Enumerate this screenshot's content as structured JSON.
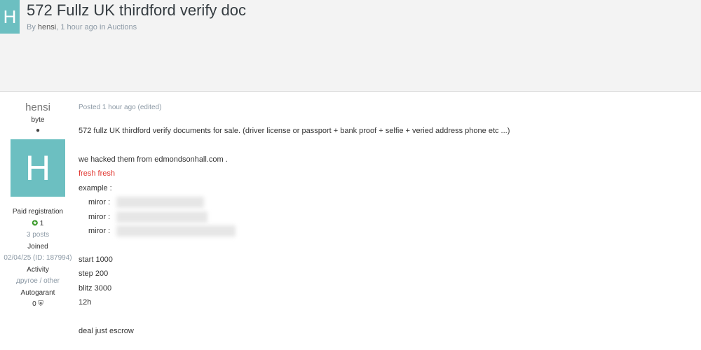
{
  "header": {
    "avatar_letter": "H",
    "title": "572 Fullz UK thirdford verify doc",
    "by_prefix": "By",
    "author": "hensi",
    "meta_suffix": ", 1 hour ago in Auctions"
  },
  "author_panel": {
    "name": "hensi",
    "rank": "byte",
    "dot": "●",
    "avatar_letter": "H",
    "group": "Paid registration",
    "reputation_icon": "reputation-plus-icon",
    "reputation_glyph": "✪",
    "reputation": "1",
    "posts": "3 posts",
    "joined_label": "Joined",
    "joined_value": "02/04/25 (ID: 187994)",
    "activity_label": "Activity",
    "activity_value": "другое / other",
    "autogarant_label": "Autogarant",
    "autogarant_value": "0",
    "autogarant_icon": "handshake-icon",
    "autogarant_glyph": "⛨"
  },
  "post": {
    "posted": "Posted 1 hour ago (edited)",
    "line1": "572 fullz UK thirdford verify documents for sale. (driver license or passport  + bank proof + selfie + veried address phone etc ...)",
    "line2": "we hacked them from edmondsonhall.com .",
    "line3": "fresh fresh",
    "line4": "example :",
    "miror_1": "miror :",
    "miror_2": "miror :",
    "miror_3": "miror :",
    "start": "start 1000",
    "step": "step 200",
    "blitz": "blitz 3000",
    "duration": "12h",
    "deal": "deal just escrow"
  }
}
